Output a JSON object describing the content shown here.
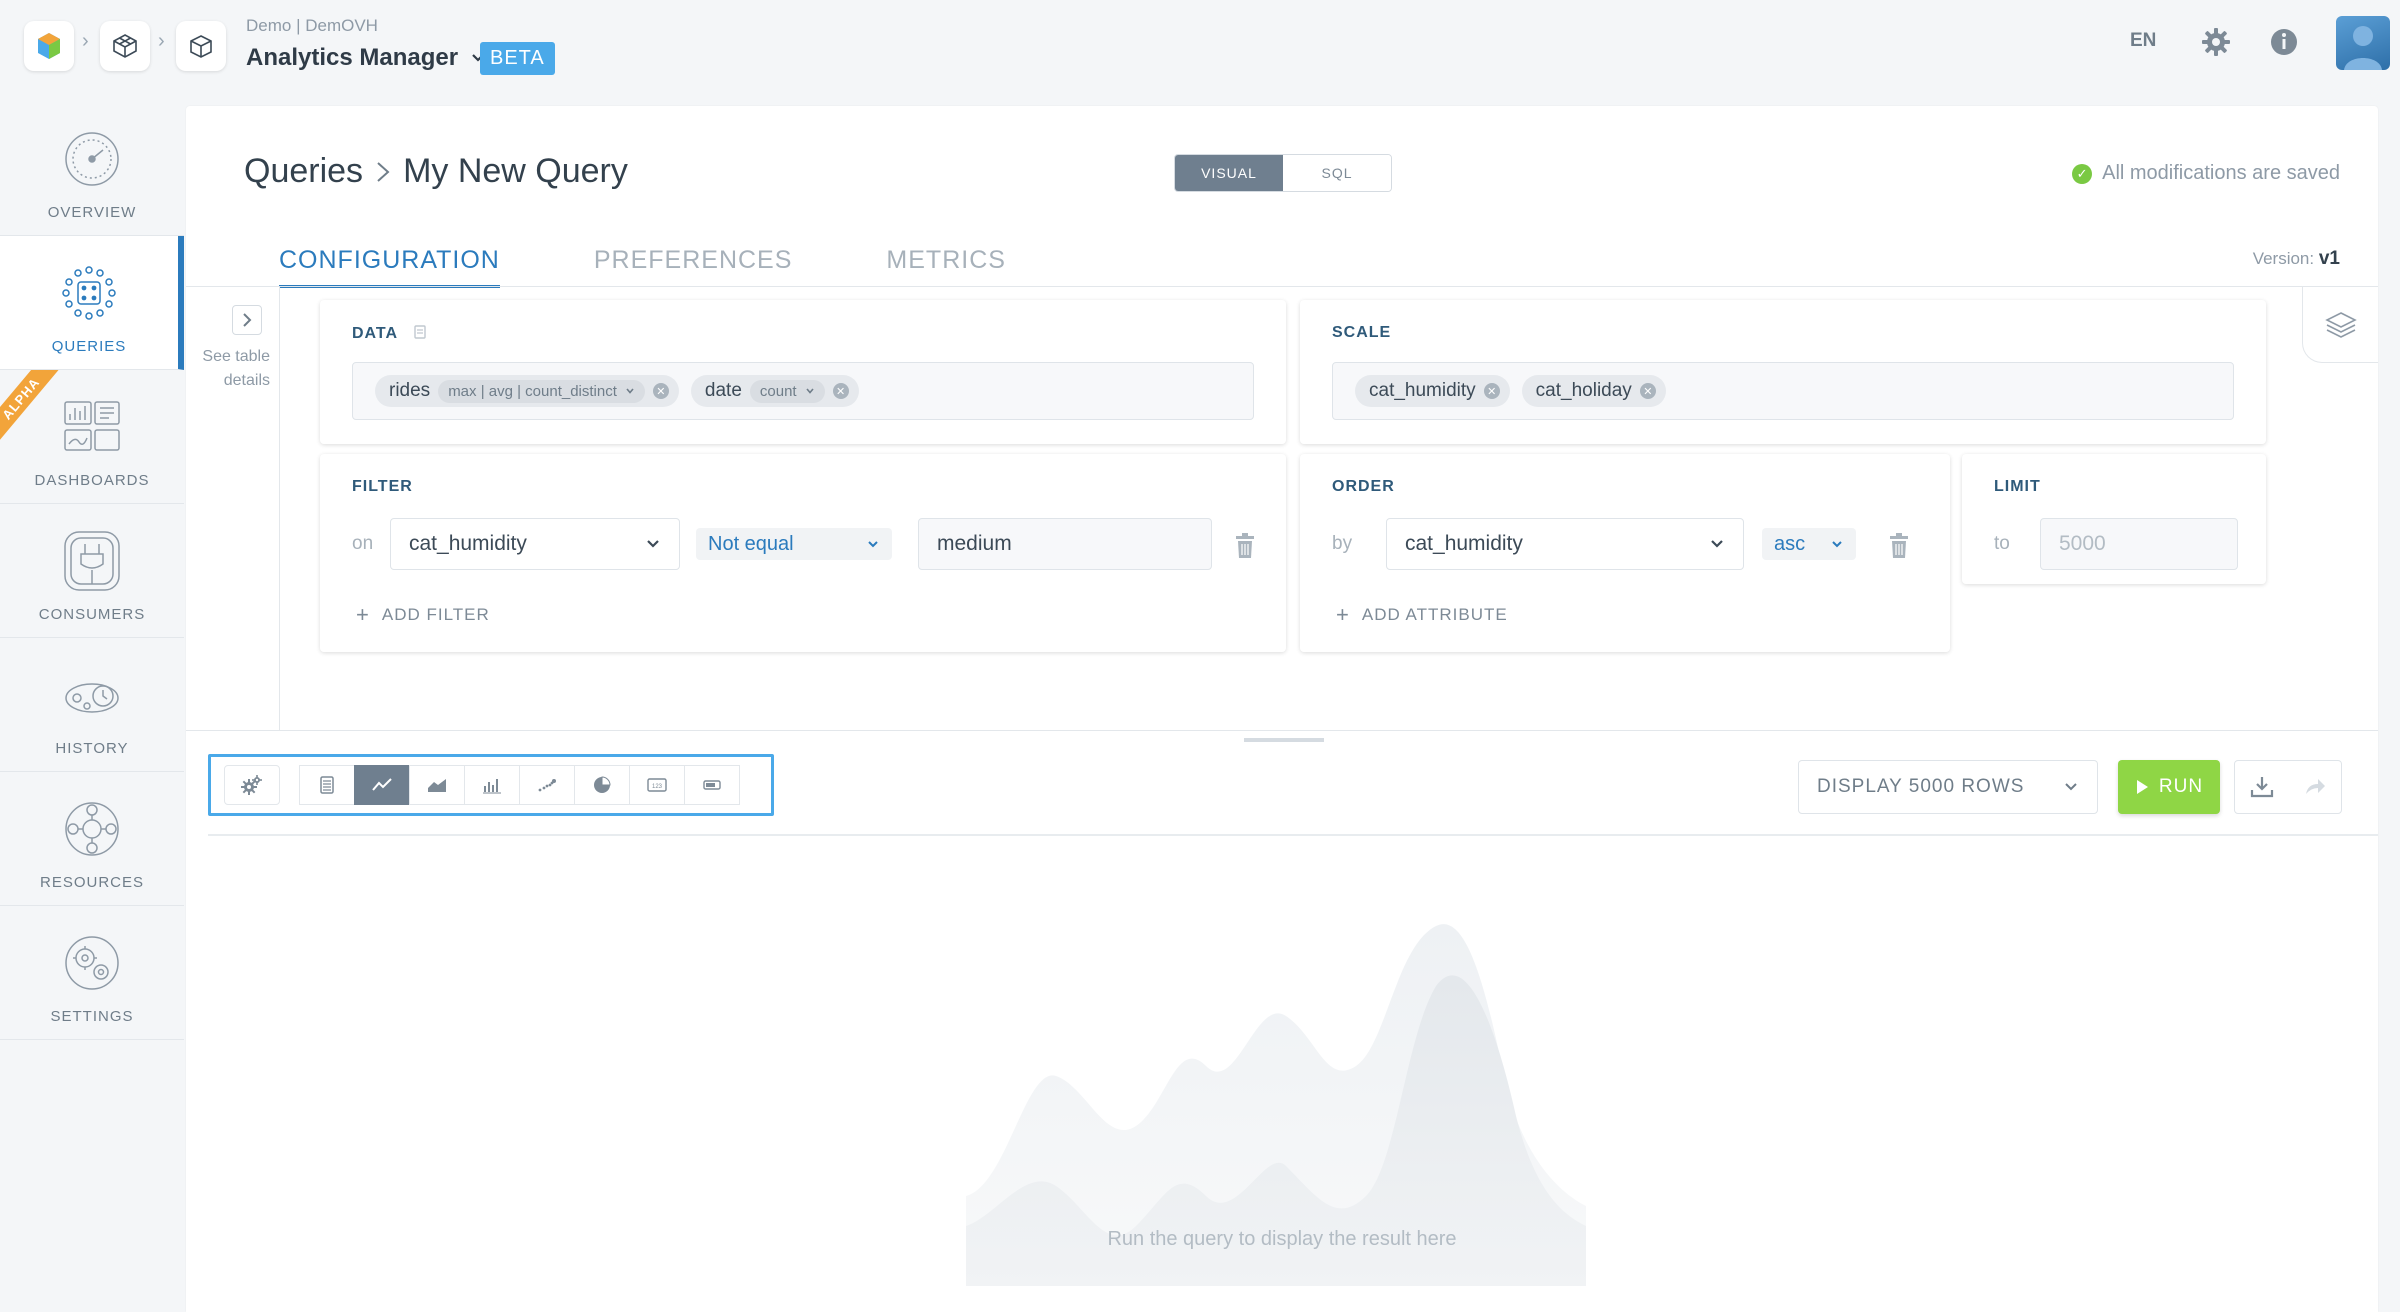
{
  "topbar": {
    "org_label": "Demo | DemOVH",
    "app_title": "Analytics Manager",
    "beta_badge": "BETA",
    "language": "EN",
    "icons": [
      "app-logo-icon",
      "project-cube-icon",
      "app-box-icon",
      "settings-gear-icon",
      "info-icon",
      "user-avatar"
    ]
  },
  "nav": {
    "items": [
      {
        "label": "OVERVIEW",
        "icon": "gauge-icon"
      },
      {
        "label": "QUERIES",
        "icon": "queries-grid-icon"
      },
      {
        "label": "DASHBOARDS",
        "icon": "dashboard-icon",
        "badge": "ALPHA"
      },
      {
        "label": "CONSUMERS",
        "icon": "plug-icon"
      },
      {
        "label": "HISTORY",
        "icon": "history-icon"
      },
      {
        "label": "RESOURCES",
        "icon": "resources-icon"
      },
      {
        "label": "SETTINGS",
        "icon": "settings-icon"
      }
    ],
    "active": "QUERIES"
  },
  "page": {
    "breadcrumb_root": "Queries",
    "breadcrumb_current": "My New Query",
    "mode_visual": "VISUAL",
    "mode_sql": "SQL",
    "save_status": "All modifications are saved",
    "version_label": "Version:",
    "version_value": "v1"
  },
  "tabs": [
    "CONFIGURATION",
    "PREFERENCES",
    "METRICS"
  ],
  "helper": {
    "see_table_details": "See table details"
  },
  "data_card": {
    "title": "DATA",
    "chips": [
      {
        "name": "rides",
        "options": "max | avg | count_distinct"
      },
      {
        "name": "date",
        "options": "count"
      }
    ]
  },
  "scale_card": {
    "title": "SCALE",
    "chips": [
      "cat_humidity",
      "cat_holiday"
    ]
  },
  "filter_card": {
    "title": "FILTER",
    "on_label": "on",
    "column": "cat_humidity",
    "operator": "Not equal",
    "value": "medium",
    "add_label": "ADD FILTER"
  },
  "order_card": {
    "title": "ORDER",
    "by_label": "by",
    "column": "cat_humidity",
    "direction": "asc",
    "add_label": "ADD ATTRIBUTE"
  },
  "limit_card": {
    "title": "LIMIT",
    "to_label": "to",
    "placeholder": "5000"
  },
  "toolbar": {
    "display_rows": "DISPLAY 5000 ROWS",
    "run_label": "RUN",
    "viz_types": [
      "table-icon",
      "line-chart-icon",
      "area-chart-icon",
      "bar-chart-icon",
      "scatter-icon",
      "pie-chart-icon",
      "kpi-number-icon",
      "gauge-bar-icon"
    ],
    "active_viz": "line-chart-icon"
  },
  "result": {
    "placeholder": "Run the query to display the result here"
  },
  "colors": {
    "accent": "#2b7bbd",
    "beta": "#4aa9e9",
    "run": "#8fd645",
    "saved": "#7ac943",
    "alpha": "#f2a43a"
  }
}
